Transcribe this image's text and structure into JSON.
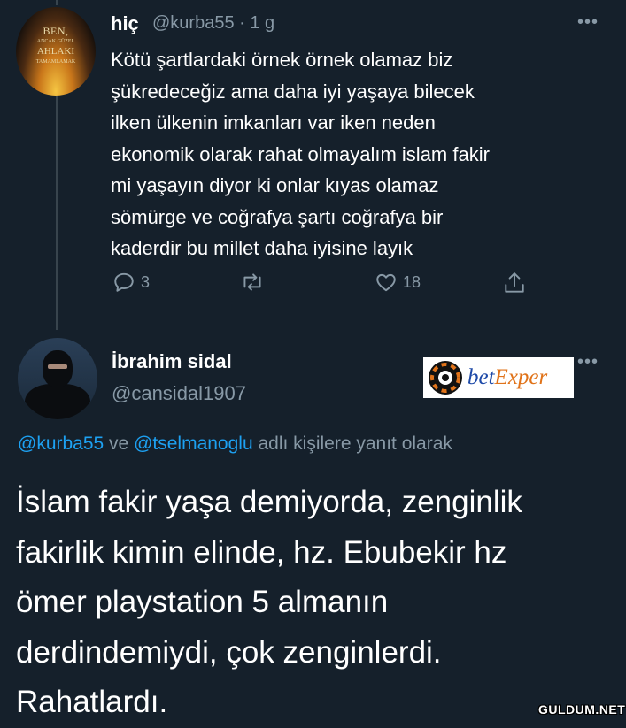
{
  "tweet": {
    "avatar_text": [
      "BEN,",
      "ANCAK GÜZEL",
      "AHLAKI",
      "TAMAMLAMAK"
    ],
    "name": "hiç",
    "handle_time": "@kurba55 · 1 g",
    "body_lines": [
      "Kötü şartlardaki örnek örnek olamaz biz",
      "şükredeceğiz ama daha iyi yaşaya bilecek",
      "ilken ülkenin imkanları var iken neden",
      "ekonomik olarak rahat olmayalım islam fakir",
      "mi yaşayın diyor ki onlar kıyas olamaz",
      "sömürge ve coğrafya şartı coğrafya bir",
      "kaderdir bu millet daha iyisine layık"
    ],
    "reply_count": "3",
    "like_count": "18"
  },
  "reply": {
    "name": "İbrahim sidal",
    "handle": "@cansidal1907",
    "replying_to": {
      "mention1": "@kurba55",
      "conj": " ve ",
      "mention2": "@tselmanoglu",
      "suffix": " adlı kişilere yanıt olarak"
    },
    "body_lines": [
      "İslam fakir yaşa demiyorda, zenginlik",
      "fakirlik kimin elinde, hz. Ebubekir hz",
      "ömer playstation 5 almanın",
      "derdindemiydi, çok zenginlerdi.",
      "Rahatlardı."
    ]
  },
  "ad": {
    "brand_prefix": "bet",
    "brand_suffix": "Exper"
  },
  "watermark": "GULDUM.NET",
  "icons": [
    "more-icon",
    "reply-icon",
    "retweet-icon",
    "like-icon",
    "share-icon",
    "poker-chip-icon"
  ],
  "colors": {
    "background": "#15202b",
    "text": "#ffffff",
    "secondary": "#8899a6",
    "link": "#1da1f2",
    "thread_line": "#38444d"
  }
}
